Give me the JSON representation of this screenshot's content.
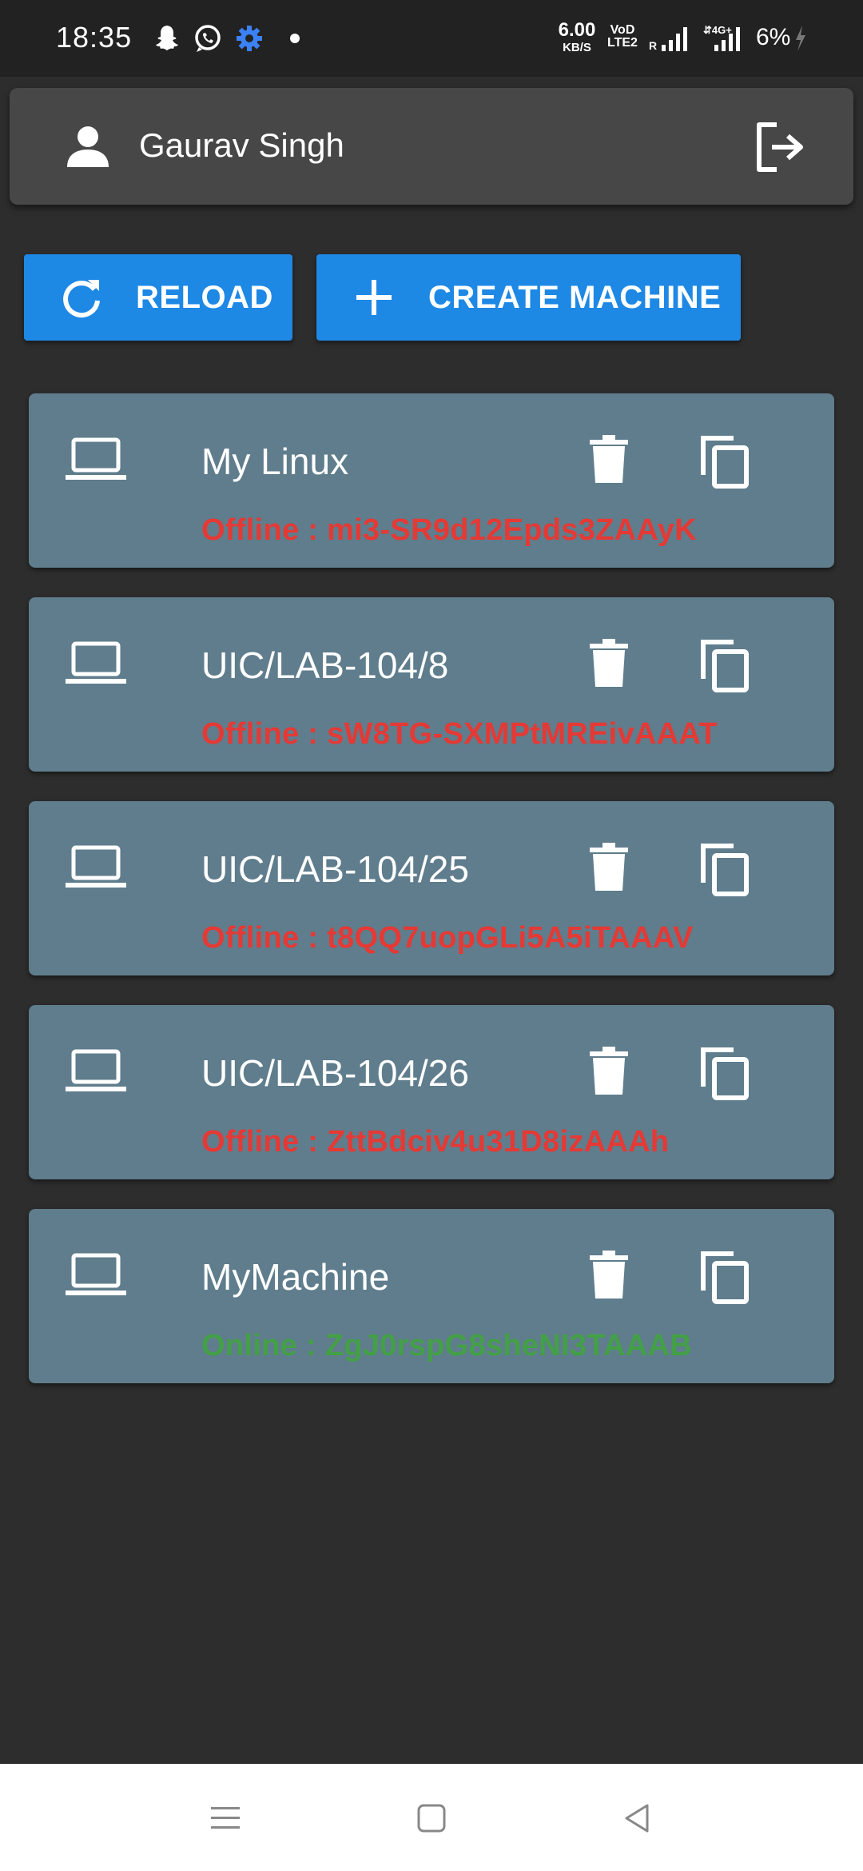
{
  "status_bar": {
    "time": "18:35",
    "speed_value": "6.00",
    "speed_unit": "KB/S",
    "volte_top": "VoD",
    "volte_bottom": "LTE2",
    "battery": "6%",
    "icons": [
      "snapchat-icon",
      "whatsapp-icon",
      "settings-gear-icon",
      "notification-dot",
      "signal-icon",
      "signal-4g-icon",
      "battery-icon"
    ]
  },
  "header": {
    "user_name": "Gaurav Singh"
  },
  "actions": {
    "reload_label": "RELOAD",
    "create_label": "CREATE MACHINE"
  },
  "machines": [
    {
      "name": "My Linux",
      "status": "Offline : mi3-SR9d12Epds3ZAAyK",
      "online": false
    },
    {
      "name": "UIC/LAB-104/8",
      "status": "Offline : sW8TG-SXMPtMREivAAAT",
      "online": false
    },
    {
      "name": "UIC/LAB-104/25",
      "status": "Offline : t8QQ7uopGLi5A5iTAAAV",
      "online": false
    },
    {
      "name": "UIC/LAB-104/26",
      "status": "Offline : ZttBdciv4u31D8izAAAh",
      "online": false
    },
    {
      "name": "MyMachine",
      "status": "Online : ZgJ0rspG8sheNI3TAAAB",
      "online": true
    }
  ],
  "colors": {
    "accent": "#1e88e5",
    "card": "#5f7d8c",
    "offline": "#e53935",
    "online": "#43a047",
    "background": "#2d2d2d"
  }
}
